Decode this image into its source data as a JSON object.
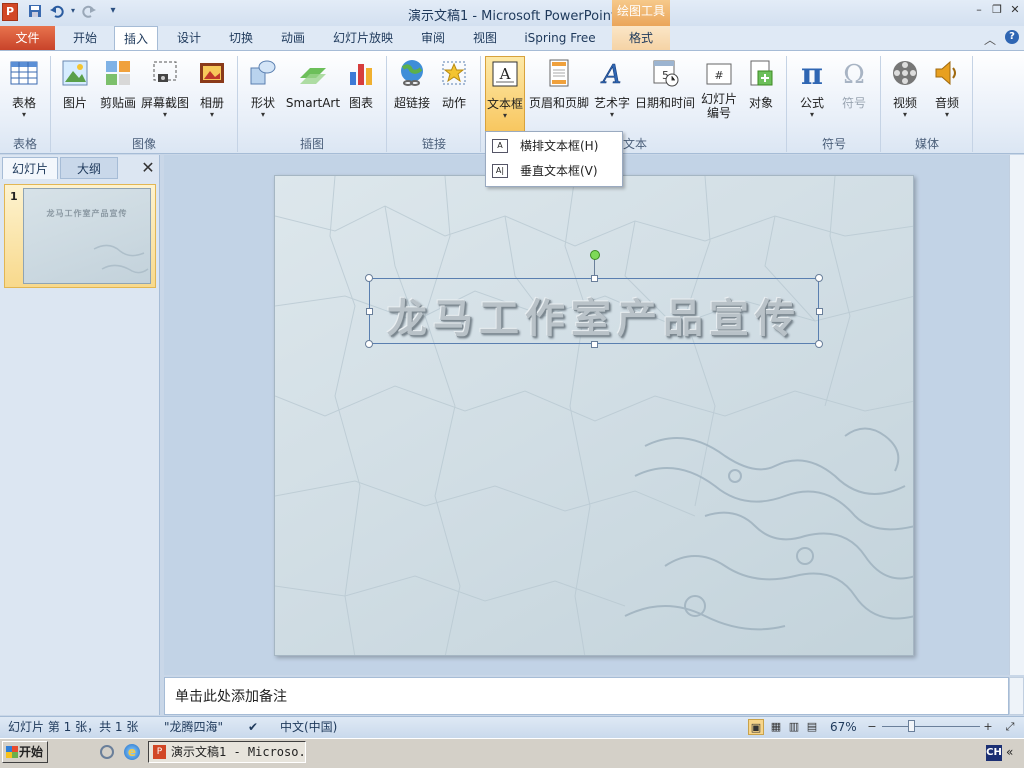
{
  "window": {
    "title": "演示文稿1 - Microsoft PowerPoint",
    "context_tab_group": "绘图工具",
    "app_icon_letter": "P",
    "qa_dropdown": "▾",
    "controls": {
      "minimize": "–",
      "restore": "❐",
      "close": "✕"
    }
  },
  "tabs": [
    "文件",
    "开始",
    "插入",
    "设计",
    "切换",
    "动画",
    "幻灯片放映",
    "审阅",
    "视图",
    "iSpring Free",
    "格式"
  ],
  "active_tab": "插入",
  "ribbon": {
    "buttons": {
      "table": "表格",
      "picture": "图片",
      "clipart": "剪贴画",
      "screenshot": "屏幕截图",
      "album": "相册",
      "shapes": "形状",
      "smartart": "SmartArt",
      "chart": "图表",
      "hyperlink": "超链接",
      "action": "动作",
      "textbox": "文本框",
      "header_footer": "页眉和页脚",
      "wordart": "艺术字",
      "datetime": "日期和时间",
      "slide_number": "幻灯片编号",
      "object": "对象",
      "equation": "公式",
      "symbol": "符号",
      "video": "视频",
      "audio": "音频"
    },
    "groups": {
      "table": "表格",
      "images": "图像",
      "illustrations": "插图",
      "links": "链接",
      "text": "文本",
      "symbols": "符号",
      "media": "媒体"
    },
    "dropdown_arrow": "▾"
  },
  "textbox_menu": [
    {
      "label": "横排文本框(H)",
      "icon": "horizontal-textbox-icon"
    },
    {
      "label": "垂直文本框(V)",
      "icon": "vertical-textbox-icon"
    }
  ],
  "panel": {
    "tab_slides": "幻灯片",
    "tab_outline": "大纲",
    "close": "✕",
    "thumb_number": "1",
    "thumb_title": "龙马工作室产品宣传"
  },
  "slide": {
    "title": "龙马工作室产品宣传"
  },
  "notes": {
    "placeholder": "单击此处添加备注"
  },
  "status": {
    "slide_info": "幻灯片 第 1 张，共 1 张",
    "theme": "\"龙腾四海\"",
    "language": "中文(中国)",
    "zoom": "67%",
    "zoom_out": "−",
    "zoom_in": "+"
  },
  "taskbar": {
    "start": "开始",
    "ppt_window": "演示文稿1 - Microso...",
    "ime": "CH",
    "tray_arrow": "«"
  },
  "colors": {
    "file_tab": "#c8432a",
    "context_tools": "#eaa55a",
    "textbox_active": "#f8c760"
  }
}
